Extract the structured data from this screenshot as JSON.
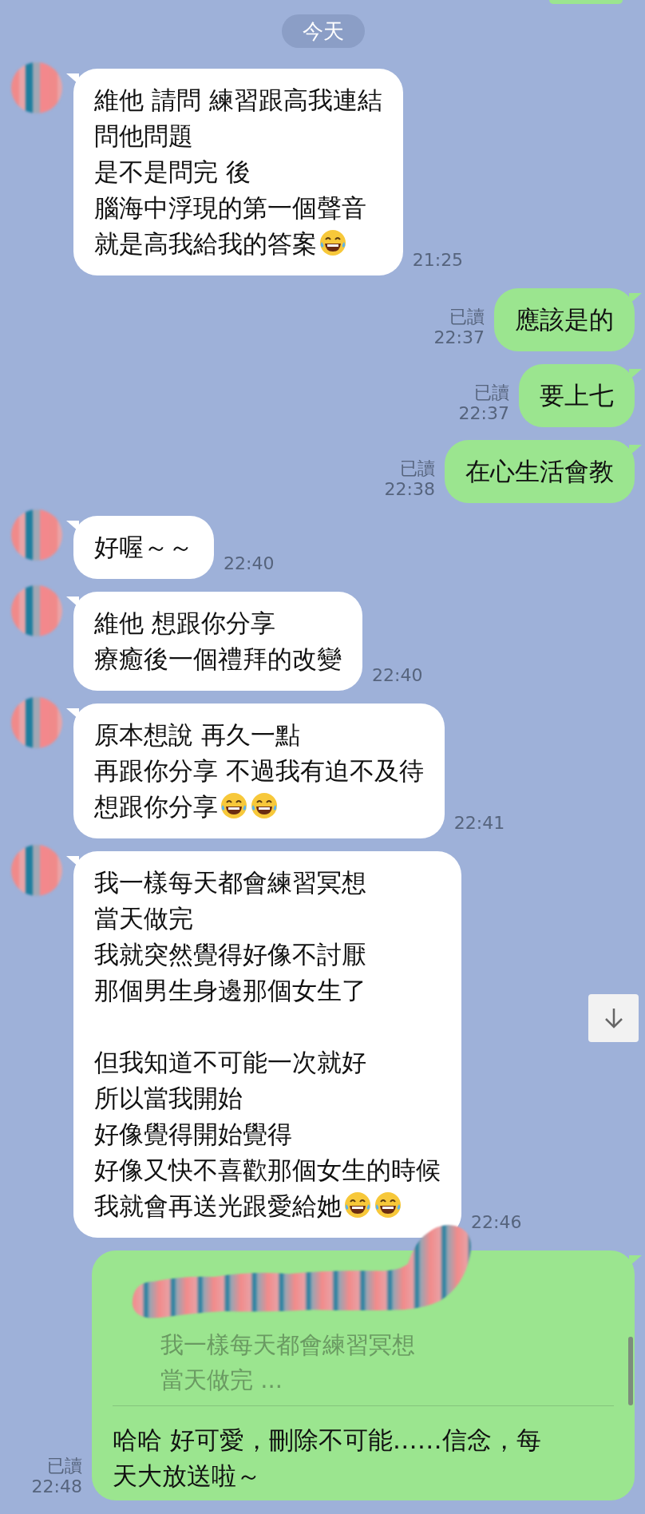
{
  "date_divider": "今天",
  "messages": [
    {
      "kind": "incoming",
      "paragraphs": [
        [
          "維他 請問 練習跟高我連結",
          "問他問題",
          "是不是問完 後",
          "腦海中浮現的第一個聲音",
          "就是高我給我的答案"
        ]
      ],
      "emojis": [
        {
          "kind": "laughing"
        }
      ],
      "time": "21:25"
    },
    {
      "kind": "outgoing",
      "paragraphs": [
        [
          "應該是的"
        ]
      ],
      "read_label": "已讀",
      "time": "22:37"
    },
    {
      "kind": "outgoing",
      "paragraphs": [
        [
          "要上七"
        ]
      ],
      "read_label": "已讀",
      "time": "22:37"
    },
    {
      "kind": "outgoing",
      "paragraphs": [
        [
          "在心生活會教"
        ]
      ],
      "read_label": "已讀",
      "time": "22:38"
    },
    {
      "kind": "incoming",
      "paragraphs": [
        [
          "好喔～～"
        ]
      ],
      "time": "22:40"
    },
    {
      "kind": "incoming",
      "paragraphs": [
        [
          "維他 想跟你分享",
          "療癒後一個禮拜的改變"
        ]
      ],
      "time": "22:40"
    },
    {
      "kind": "incoming",
      "paragraphs": [
        [
          "原本想說 再久一點",
          "再跟你分享 不過我有迫不及待",
          "想跟你分享"
        ]
      ],
      "emojis": [
        {
          "kind": "laughing"
        },
        {
          "kind": "laughing"
        }
      ],
      "time": "22:41"
    },
    {
      "kind": "incoming",
      "paragraphs": [
        [
          "我一樣每天都會練習冥想",
          "當天做完",
          "我就突然覺得好像不討厭",
          "那個男生身邊那個女生了"
        ],
        [
          "但我知道不可能一次就好",
          "所以當我開始",
          "好像覺得開始覺得",
          "好像又快不喜歡那個女生的時候",
          "我就會再送光跟愛給她"
        ]
      ],
      "emojis": [
        {
          "kind": "laughing"
        },
        {
          "kind": "laughing"
        }
      ],
      "time": "22:46"
    },
    {
      "kind": "reply",
      "quote": [
        "我一樣每天都會練習冥想",
        "當天做完 ..."
      ],
      "paragraphs": [
        [
          "哈哈 好可愛，刪除不可能……信念，每",
          "天大放送啦～"
        ]
      ],
      "read_label": "已讀",
      "time": "22:48"
    }
  ]
}
